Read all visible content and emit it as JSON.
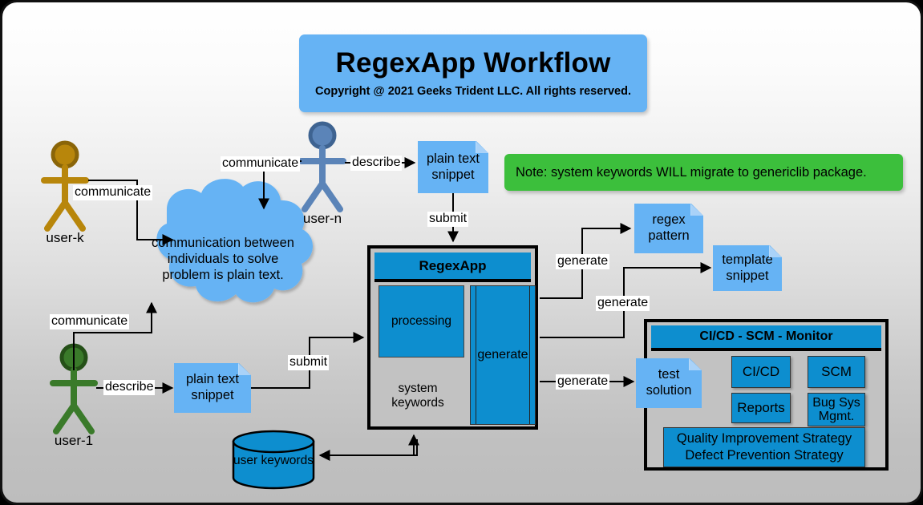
{
  "title": {
    "main": "RegexApp Workflow",
    "subtitle": "Copyright @ 2021 Geeks Trident LLC.  All rights reserved."
  },
  "note": {
    "text": "Note: system keywords WILL migrate to genericlib package.",
    "color": "#3cbf3c"
  },
  "colors": {
    "accent_blue": "#0d8ecf",
    "light_blue": "#66b3f4",
    "green_note": "#3cbf3c",
    "actor_user_k": "#b8860b",
    "actor_user_n": "#5b84b8",
    "actor_user_1": "#3a7a2a",
    "board_top": "#ffffff",
    "board_bottom": "#bdbdbd"
  },
  "actors": [
    {
      "id": "user-k",
      "label": "user-k",
      "color": "#b8860b"
    },
    {
      "id": "user-n",
      "label": "user-n",
      "color": "#5b84b8"
    },
    {
      "id": "user-1",
      "label": "user-1",
      "color": "#3a7a2a"
    }
  ],
  "cloud": {
    "text": "communication between individuals to solve problem is plain text."
  },
  "documents": {
    "plain_text_snippet_top": "plain text snippet",
    "plain_text_snippet_bottom": "plain text snippet",
    "regex_pattern": "regex pattern",
    "template_snippet": "template snippet",
    "test_solution": "test solution"
  },
  "regexapp": {
    "header": "RegexApp",
    "processing": "processing",
    "system_keywords": "system keywords",
    "generate": "generate"
  },
  "datastores": {
    "user_keywords": "user keywords"
  },
  "cicd": {
    "header": "CI/CD - SCM - Monitor",
    "cells": [
      {
        "id": "cicd",
        "label": "CI/CD"
      },
      {
        "id": "scm",
        "label": "SCM"
      },
      {
        "id": "reports",
        "label": "Reports"
      },
      {
        "id": "bug-sys-mgmt",
        "label": "Bug Sys Mgmt."
      },
      {
        "id": "strategy",
        "label": "Quality Improvement Strategy Defect Prevention Strategy"
      }
    ],
    "strategy_line1": "Quality Improvement Strategy",
    "strategy_line2": "Defect Prevention Strategy"
  },
  "edges": {
    "communicate_k": "communicate",
    "communicate_n": "communicate",
    "communicate_1": "communicate",
    "describe_n": "describe",
    "describe_1": "describe",
    "submit_top": "submit",
    "submit_left": "submit",
    "generate_regex": "generate",
    "generate_template": "generate",
    "generate_test": "generate"
  }
}
